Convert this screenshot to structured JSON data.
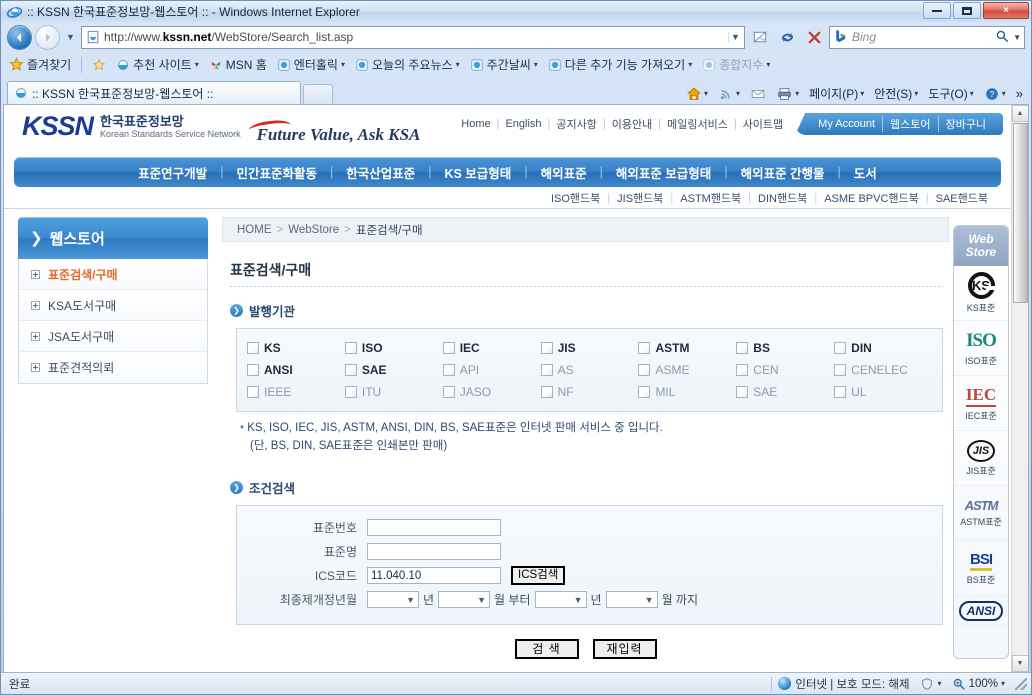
{
  "browser": {
    "title": ":: KSSN 한국표준정보망-웹스토어 :: - Windows Internet Explorer",
    "url_prefix": "http://www.",
    "url_bold": "kssn.net",
    "url_suffix": "/WebStore/Search_list.asp",
    "search_engine": "Bing",
    "tab_label": ":: KSSN 한국표준정보망-웹스토어 ::",
    "minimize_label": "최소화",
    "maximize_label": "최대화",
    "close_label": "×",
    "back_glyph": "◀",
    "forward_glyph": "▶",
    "favorites": {
      "label": "즐겨찾기",
      "items": [
        {
          "label": "추천 사이트",
          "caret": "▾"
        },
        {
          "label": "MSN 홈",
          "caret": ""
        },
        {
          "label": "엔터홀릭",
          "caret": "▾"
        },
        {
          "label": "오늘의 주요뉴스",
          "caret": "▾"
        },
        {
          "label": "주간날씨",
          "caret": "▾"
        },
        {
          "label": "다른 추가 기능 가져오기",
          "caret": "▾"
        },
        {
          "label": "종합지수",
          "caret": "▾"
        }
      ]
    },
    "command_bar": [
      {
        "label": "페이지(P)",
        "caret": "▾"
      },
      {
        "label": "안전(S)",
        "caret": "▾"
      },
      {
        "label": "도구(O)",
        "caret": "▾"
      }
    ],
    "overflow": "»",
    "status": {
      "text": "완료",
      "zone": "인터넷 | 보호 모드: 해제",
      "zoom": "100%",
      "zoom_caret": "▾",
      "zone_caret": "▾"
    }
  },
  "site": {
    "logo": {
      "mark": "KSSN",
      "kr": "한국표준정보망",
      "en": "Korean Standards Service Network"
    },
    "slogan": "Future Value, Ask KSA",
    "top_links": [
      "Home",
      "English",
      "공지사항",
      "이용안내",
      "메일링서비스",
      "사이트맵"
    ],
    "account_tabs": [
      "My Account",
      "웹스토어",
      "장바구니"
    ],
    "main_nav": [
      "표준연구개발",
      "민간표준화활동",
      "한국산업표준",
      "KS 보급형태",
      "해외표준",
      "해외표준 보급형태",
      "해외표준 간행물",
      "도서"
    ],
    "sub_nav": [
      "ISO핸드북",
      "JIS핸드북",
      "ASTM핸드북",
      "DIN핸드북",
      "ASME BPVC핸드북",
      "SAE핸드북"
    ],
    "sidebar": {
      "header": "웹스토어",
      "chevron": "❯",
      "items": [
        {
          "label": "표준검색/구매",
          "active": true
        },
        {
          "label": "KSA도서구매",
          "active": false
        },
        {
          "label": "JSA도서구매",
          "active": false
        },
        {
          "label": "표준견적의뢰",
          "active": false
        }
      ]
    },
    "breadcrumb": {
      "items": [
        "HOME",
        "WebStore",
        "표준검색/구매"
      ],
      "sep": ">"
    },
    "page_title": "표준검색/구매",
    "sections": {
      "issuer": {
        "heading": "발행기관",
        "arrow": "❯",
        "columns": [
          [
            {
              "label": "KS",
              "strong": true
            },
            {
              "label": "ANSI",
              "strong": true
            },
            {
              "label": "IEEE",
              "strong": false
            }
          ],
          [
            {
              "label": "ISO",
              "strong": true
            },
            {
              "label": "SAE",
              "strong": true
            },
            {
              "label": "ITU",
              "strong": false
            }
          ],
          [
            {
              "label": "IEC",
              "strong": true
            },
            {
              "label": "API",
              "strong": false
            },
            {
              "label": "JASO",
              "strong": false
            }
          ],
          [
            {
              "label": "JIS",
              "strong": true
            },
            {
              "label": "AS",
              "strong": false
            },
            {
              "label": "NF",
              "strong": false
            }
          ],
          [
            {
              "label": "ASTM",
              "strong": true
            },
            {
              "label": "ASME",
              "strong": false
            },
            {
              "label": "MIL",
              "strong": false
            }
          ],
          [
            {
              "label": "BS",
              "strong": true
            },
            {
              "label": "CEN",
              "strong": false
            },
            {
              "label": "SAE",
              "strong": false
            }
          ],
          [
            {
              "label": "DIN",
              "strong": true
            },
            {
              "label": "CENELEC",
              "strong": false
            },
            {
              "label": "UL",
              "strong": false
            }
          ]
        ],
        "note_bullet": "•",
        "note_line1": "KS, ISO, IEC, JIS, ASTM, ANSI, DIN, BS, SAE표준은 인터넷 판매 서비스 중 입니다.",
        "note_line2": "(단, BS, DIN, SAE표준은 인쇄본만 판매)"
      },
      "condition": {
        "heading": "조건검색",
        "arrow": "❯",
        "fields": {
          "std_no_label": "표준번호",
          "std_no_value": "",
          "std_name_label": "표준명",
          "std_name_value": "",
          "ics_label": "ICS코드",
          "ics_value": "11.040.10",
          "ics_button": "ICS검색",
          "revision_label": "최종제개정년월",
          "from_year": "",
          "from_year_unit": "년",
          "from_month": "",
          "from_month_unit": "월 부터",
          "to_year": "",
          "to_year_unit": "년",
          "to_month": "",
          "to_month_unit": "월 까지",
          "select_caret": "▼"
        },
        "buttons": {
          "search": "검 색",
          "reset": "재입력"
        }
      }
    },
    "right_rail": {
      "title_line1": "Web",
      "title_line2": "Store",
      "items": [
        {
          "mark": "KS",
          "caption": "KS표준"
        },
        {
          "mark": "ISO",
          "caption": "ISO표준"
        },
        {
          "mark": "IEC",
          "caption": "IEC표준"
        },
        {
          "mark": "JIS",
          "caption": "JIS표준"
        },
        {
          "mark": "ASTM",
          "caption": "ASTM표준"
        },
        {
          "mark": "BSI",
          "caption": "BS표준"
        },
        {
          "mark": "ANSI",
          "caption": ""
        }
      ]
    }
  },
  "colors": {
    "accent_blue": "#2f79bd",
    "nav_blue": "#3b82c8",
    "active_orange": "#e8682a",
    "note_blue": "#2b4a72"
  }
}
